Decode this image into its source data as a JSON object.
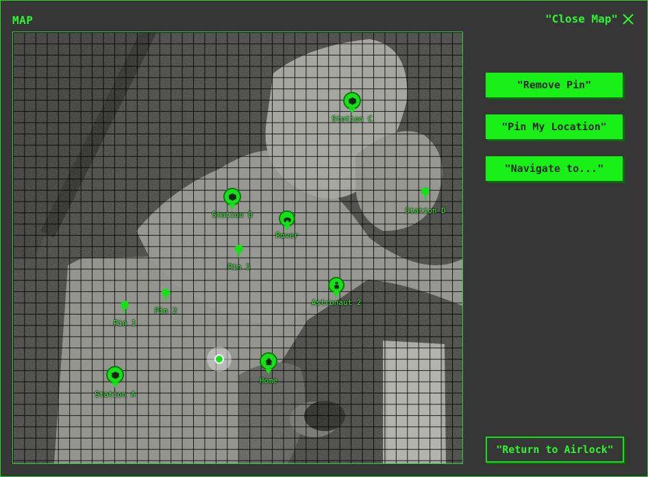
{
  "header": {
    "title": "MAP",
    "close_label": "\"Close Map\""
  },
  "actions": {
    "remove_pin": "\"Remove Pin\"",
    "pin_location": "\"Pin My Location\"",
    "navigate": "\"Navigate to...\"",
    "return_airlock": "\"Return to Airlock\""
  },
  "markers": {
    "station_c": "Station C",
    "station_d": "Station D",
    "station_b": "Station B",
    "rover": "Rover",
    "pin_3": "Pin 3",
    "astronaut_2": "Astronaut 2",
    "pin_1": "Pin 1",
    "pin_2": "Pin 2",
    "home": "Home",
    "station_a": "Station A"
  },
  "colors": {
    "accent": "#18f018",
    "background": "#363636"
  }
}
